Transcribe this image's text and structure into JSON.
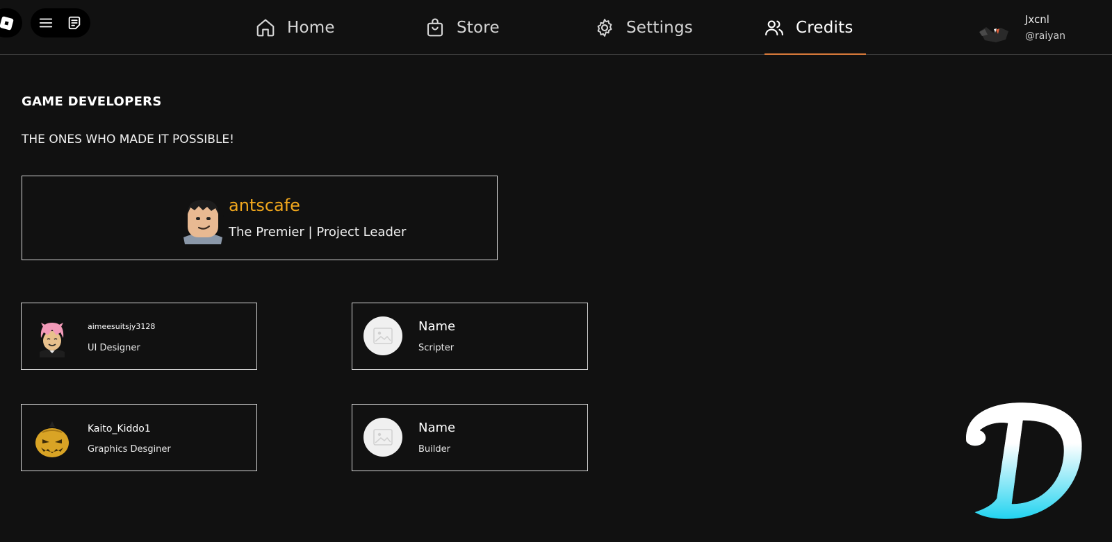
{
  "nav": {
    "items": [
      {
        "label": "Home",
        "icon": "home-icon"
      },
      {
        "label": "Store",
        "icon": "shopping-bag-icon"
      },
      {
        "label": "Settings",
        "icon": "gear-icon"
      },
      {
        "label": "Credits",
        "icon": "users-icon",
        "active": true
      }
    ]
  },
  "user": {
    "display_name": "Jxcnl",
    "handle": "@raiyan"
  },
  "section": {
    "title": "GAME DEVELOPERS",
    "subtitle": "THE ONES WHO MADE IT POSSIBLE!"
  },
  "lead": {
    "name": "antscafe",
    "role": "The Premier  | Project Leader"
  },
  "credits": [
    {
      "name": "aimeesuitsjy3128",
      "role": "UI Designer"
    },
    {
      "name": "Name",
      "role": "Scripter"
    },
    {
      "name": "Kaito_Kiddo1",
      "role": "Graphics Desginer"
    },
    {
      "name": "Name",
      "role": "Builder"
    }
  ],
  "colors": {
    "background": "#111111",
    "accent_underline": "#d97a3a",
    "lead_name": "#f2a81d",
    "card_border": "#d9d9d9",
    "logo_gradient": [
      "#ffffff",
      "#22d3f0"
    ]
  }
}
